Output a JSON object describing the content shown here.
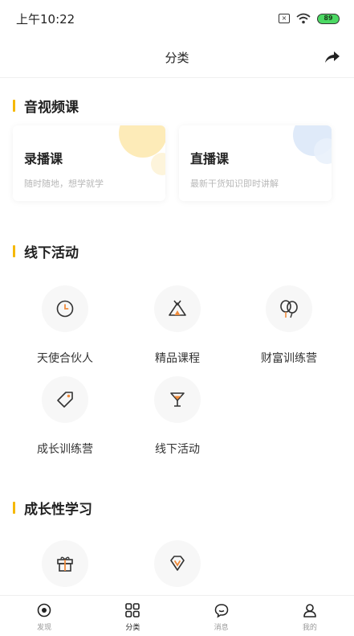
{
  "status_bar": {
    "time": "上午10:22",
    "battery": "89"
  },
  "nav": {
    "title": "分类"
  },
  "sections": {
    "av_courses": {
      "title": "音视频课",
      "cards": [
        {
          "title": "录播课",
          "subtitle": "随时随地，想学就学",
          "deco_color": "#fde9b0"
        },
        {
          "title": "直播课",
          "subtitle": "最新干货知识即时讲解",
          "deco_color": "#dbe8f8"
        }
      ]
    },
    "offline": {
      "title": "线下活动",
      "items": [
        {
          "label": "天使合伙人",
          "icon": "clock-icon"
        },
        {
          "label": "精品课程",
          "icon": "tent-icon"
        },
        {
          "label": "财富训练营",
          "icon": "balloons-icon"
        },
        {
          "label": "成长训练营",
          "icon": "tag-icon"
        },
        {
          "label": "线下活动",
          "icon": "cocktail-icon"
        }
      ]
    },
    "growth": {
      "title": "成长性学习",
      "items": [
        {
          "label": "",
          "icon": "gift-icon"
        },
        {
          "label": "",
          "icon": "diamond-icon"
        }
      ]
    }
  },
  "tabbar": {
    "tabs": [
      {
        "label": "发现",
        "icon": "discover-icon",
        "active": false
      },
      {
        "label": "分类",
        "icon": "category-icon",
        "active": true
      },
      {
        "label": "消息",
        "icon": "message-icon",
        "active": false
      },
      {
        "label": "我的",
        "icon": "profile-icon",
        "active": false
      }
    ]
  },
  "colors": {
    "accent": "#f5b800",
    "icon_orange": "#f08c3c"
  }
}
